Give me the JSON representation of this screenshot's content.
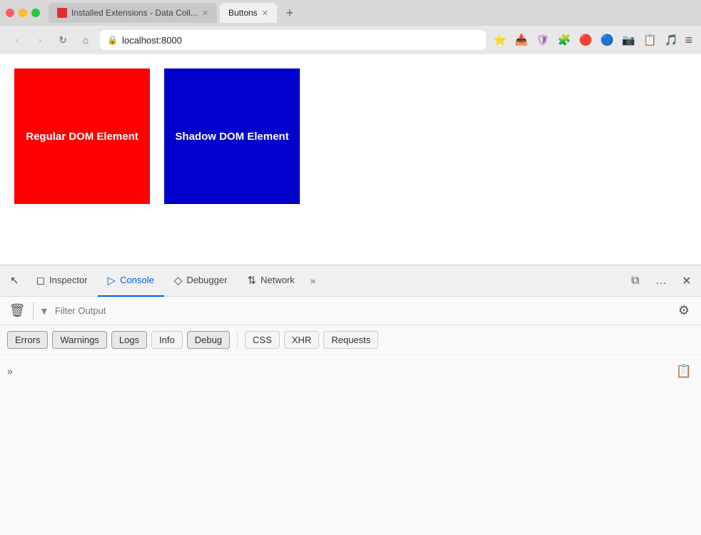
{
  "browser": {
    "traffic_lights": [
      "red",
      "yellow",
      "green"
    ],
    "tabs": [
      {
        "id": "installed-extensions",
        "label": "Installed Extensions - Data Coll...",
        "active": false,
        "favicon": true
      },
      {
        "id": "buttons",
        "label": "Buttons",
        "active": true,
        "favicon": false
      }
    ],
    "new_tab_label": "+",
    "address": "localhost:8000",
    "nav": {
      "back_label": "‹",
      "forward_label": "›",
      "reload_label": "↻",
      "home_label": "⌂"
    }
  },
  "page": {
    "elements": [
      {
        "id": "regular",
        "label": "Regular DOM Element",
        "color": "red"
      },
      {
        "id": "shadow",
        "label": "Shadow DOM Element",
        "color": "blue"
      }
    ]
  },
  "devtools": {
    "tabs": [
      {
        "id": "inspector",
        "label": "Inspector",
        "icon": "◻",
        "active": false
      },
      {
        "id": "console",
        "label": "Console",
        "icon": "▷",
        "active": true
      },
      {
        "id": "debugger",
        "label": "Debugger",
        "icon": "◇",
        "active": false
      },
      {
        "id": "network",
        "label": "Network",
        "icon": "⇅",
        "active": false
      }
    ],
    "more_label": "»",
    "actions": {
      "dock_label": "⧉",
      "overflow_label": "…",
      "close_label": "✕"
    }
  },
  "console": {
    "filter_placeholder": "Filter Output",
    "filter_tabs": [
      {
        "id": "errors",
        "label": "Errors",
        "active": true
      },
      {
        "id": "warnings",
        "label": "Warnings",
        "active": true
      },
      {
        "id": "logs",
        "label": "Logs",
        "active": true
      },
      {
        "id": "info",
        "label": "Info",
        "active": false
      },
      {
        "id": "debug",
        "label": "Debug",
        "active": true
      }
    ],
    "extra_filters": [
      {
        "id": "css",
        "label": "CSS",
        "active": false
      },
      {
        "id": "xhr",
        "label": "XHR",
        "active": false
      },
      {
        "id": "requests",
        "label": "Requests",
        "active": false
      }
    ],
    "expand_label": "»"
  }
}
